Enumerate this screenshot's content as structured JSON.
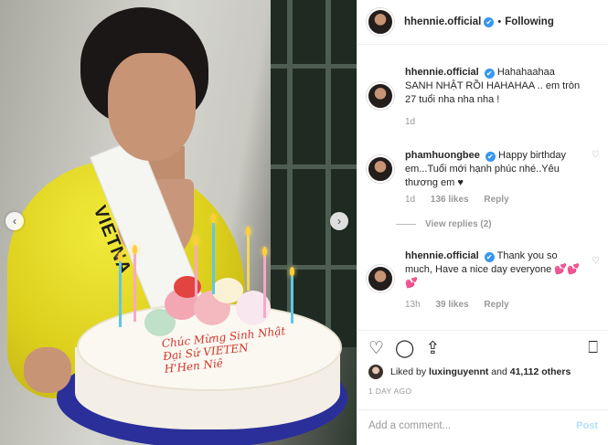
{
  "header": {
    "username": "hhennie.official",
    "verified_mark": "✔",
    "separator": "•",
    "follow_status": "Following"
  },
  "photo": {
    "sash_text": "VIETNA",
    "cake_writing": [
      "Chúc Mừng Sinh Nhật",
      "Đại Sứ VIETEN",
      "H'Hen Niê"
    ],
    "prev_icon": "‹",
    "next_icon": "›"
  },
  "comments": [
    {
      "username": "hhennie.official",
      "text": "Hahahaahaa SANH NHẬT RỒI HAHAHAA .. em tròn 27 tuổi nha nha nha !",
      "time": "1d"
    },
    {
      "username": "phamhuongbee",
      "text": "Happy birthday em...Tuổi mới hạnh phúc nhé..Yêu thương em ♥",
      "time": "1d",
      "likes": "136 likes",
      "reply_label": "Reply",
      "view_replies": "View replies (2)"
    },
    {
      "username": "hhennie.official",
      "text": "Thank you so much, Have a nice day everyone 💕💕💕",
      "time": "13h",
      "likes": "39 likes",
      "reply_label": "Reply"
    }
  ],
  "actions": {
    "heart_icon": "♡",
    "comment_icon": "◯",
    "share_icon": "⇪",
    "bookmark_icon": "⎕"
  },
  "likes_line": {
    "prefix": "Liked by",
    "user": "luxinguyennt",
    "and": "and",
    "count": "41,112 others"
  },
  "post_time": "1 DAY AGO",
  "add_comment": {
    "placeholder": "Add a comment...",
    "post_label": "Post"
  },
  "colors": {
    "verified": "#3897f0",
    "post_disabled": "#b2dffc",
    "dress": "#dccf1c"
  }
}
